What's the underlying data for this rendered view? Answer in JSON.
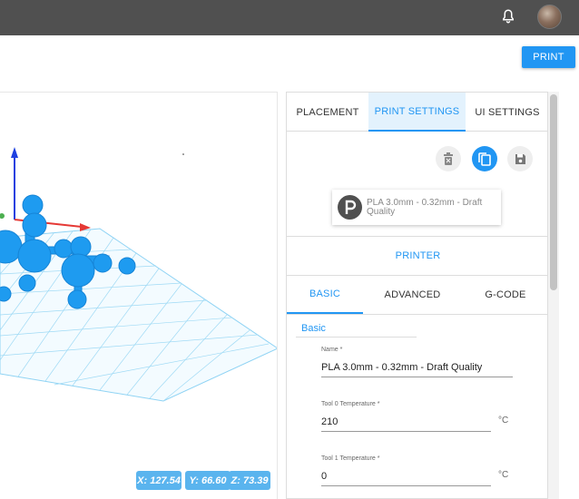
{
  "header": {
    "bell_icon": "bell-icon",
    "avatar": "user-avatar",
    "print_label": "PRINT"
  },
  "viewport": {
    "coords": {
      "x": "X: 127.54",
      "y": "Y: 66.60",
      "z": "Z: 73.39"
    },
    "colors": {
      "grid": "#8fd3f4",
      "model": "#1e9bf0",
      "axis_x": "#e53935",
      "axis_y": "#4caf50",
      "axis_z": "#1e40e0"
    }
  },
  "panel": {
    "tabs": [
      "PLACEMENT",
      "PRINT SETTINGS",
      "UI SETTINGS"
    ],
    "actions": {
      "delete": "delete-icon",
      "copy": "copy-icon",
      "save": "save-icon"
    },
    "profile": {
      "name": "PLA 3.0mm - 0.32mm - Draft Quality"
    },
    "printer_label": "PRINTER",
    "sub_tabs": [
      "BASIC",
      "ADVANCED",
      "G-CODE"
    ],
    "section_title": "Basic",
    "fields": {
      "name": {
        "label": "Name *",
        "value": "PLA 3.0mm - 0.32mm - Draft Quality"
      },
      "tool0": {
        "label": "Tool 0 Temperature *",
        "value": "210",
        "unit": "°C"
      },
      "tool1": {
        "label": "Tool 1 Temperature *",
        "value": "0",
        "unit": "°C"
      }
    }
  }
}
